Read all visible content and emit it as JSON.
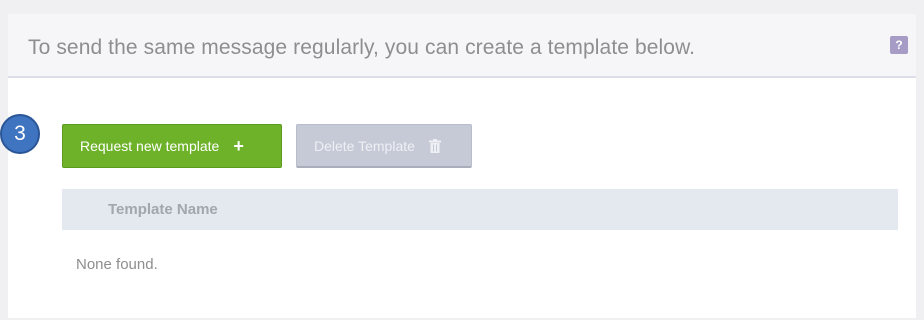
{
  "header": {
    "text": "To send the same message regularly, you can create a template below.",
    "help_label": "?"
  },
  "step_badge": "3",
  "toolbar": {
    "request_label": "Request new template",
    "request_icon": "+",
    "delete_label": "Delete Template"
  },
  "table": {
    "columns": [
      "Template Name"
    ],
    "empty_message": "None found."
  },
  "colors": {
    "primary_green": "#6db229",
    "disabled_gray": "#c5cad6",
    "help_purple": "#a79cc6",
    "badge_blue": "#3f74c1"
  }
}
